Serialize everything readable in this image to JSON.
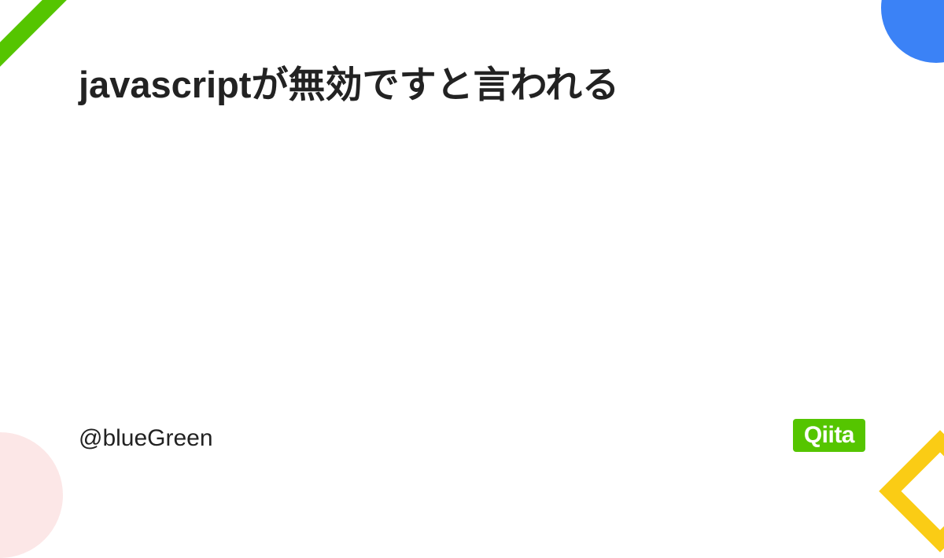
{
  "title": "javascriptが無効ですと言われる",
  "author": "@blueGreen",
  "logo": "Qiita",
  "colors": {
    "brand_green": "#55c500",
    "accent_blue": "#3b82f6",
    "accent_yellow": "#facc15",
    "accent_pink": "#fce7e7"
  }
}
